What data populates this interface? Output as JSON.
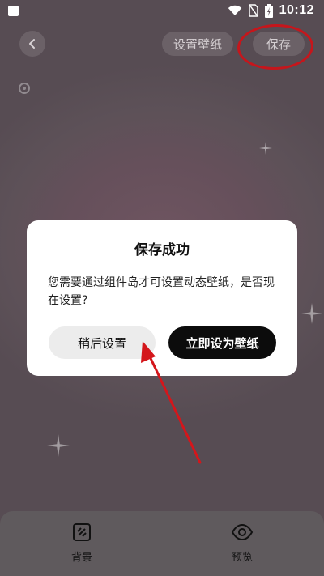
{
  "status_bar": {
    "time": "10:12"
  },
  "toolbar": {
    "set_wallpaper_label": "设置壁纸",
    "save_label": "保存"
  },
  "dialog": {
    "title": "保存成功",
    "message": "您需要通过组件岛才可设置动态壁纸，是否现在设置?",
    "later_label": "稍后设置",
    "now_label": "立即设为壁纸"
  },
  "bottom_nav": {
    "background_label": "背景",
    "preview_label": "预览"
  },
  "colors": {
    "annotation_red": "#c5161c",
    "primary_button": "#0c0c0c"
  },
  "icons": [
    "back-icon",
    "background-icon",
    "eye-icon",
    "wifi-icon",
    "battery-icon",
    "sparkle-icon"
  ]
}
